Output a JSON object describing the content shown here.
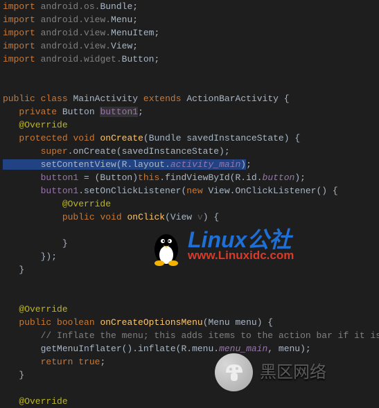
{
  "code": {
    "l1": {
      "kw": "import",
      "p": "android.os.",
      "c": "Bundle",
      "e": ";"
    },
    "l2": {
      "kw": "import",
      "p": "android.view.",
      "c": "Menu",
      "e": ";"
    },
    "l3": {
      "kw": "import",
      "p": "android.view.",
      "c": "MenuItem",
      "e": ";"
    },
    "l4": {
      "kw": "import",
      "p": "android.view.",
      "c": "View",
      "e": ";"
    },
    "l5": {
      "kw": "import",
      "p": "android.widget.",
      "c": "Button",
      "e": ";"
    },
    "l6": "",
    "l7": "",
    "l8": {
      "kw1": "public",
      "kw2": "class",
      "name": "MainActivity",
      "ext": "extends",
      "sup": "ActionBarActivity",
      "br": "{"
    },
    "l9": {
      "kw": "private",
      "type": "Button",
      "fld": "button1",
      "e": ";"
    },
    "l10": {
      "ann": "@Override"
    },
    "l11": {
      "kw1": "protected",
      "kw2": "void",
      "m": "onCreate",
      "sig": "(Bundle savedInstanceState) {"
    },
    "l12": {
      "kw": "super",
      "m": ".onCreate(savedInstanceState)",
      "e": ";"
    },
    "l13": {
      "pre": "setContentView",
      "lp": "(",
      "a": "R",
      "b": ".layout.",
      "c": "activity_main",
      "rp": ")",
      "e": ";"
    },
    "l14": {
      "fld": "button1",
      "eq": " = (Button)",
      "kw": "this",
      "m": ".findViewById(",
      "a": "R",
      "b": ".id.",
      "c": "button",
      "rp": ")",
      "e": ";"
    },
    "l15": {
      "fld": "button1",
      "m": ".setOnClickListener(",
      "kw": "new",
      "sp": " View.OnClickListener() {"
    },
    "l16": {
      "ann": "@Override"
    },
    "l17": {
      "kw1": "public",
      "kw2": "void",
      "m": "onClick",
      "sig": "(View ",
      "dim": "v",
      "sig2": ") {"
    },
    "l18": "",
    "l19": {
      "br": "}"
    },
    "l20": {
      "br": "});"
    },
    "l21": {
      "br": "}"
    },
    "l22": "",
    "l23": "",
    "l24": {
      "ann": "@Override"
    },
    "l25": {
      "kw1": "public",
      "kw2": "boolean",
      "m": "onCreateOptionsMenu",
      "sig": "(Menu menu) {"
    },
    "l26": {
      "cmt": "// Inflate the menu; this adds items to the action bar if it is present."
    },
    "l27": {
      "a": "getMenuInflater().inflate(",
      "r": "R",
      "b": ".menu.",
      "c": "menu_main",
      "d": ", menu)",
      "e": ";"
    },
    "l28": {
      "kw": "return",
      "v": "true",
      "e": ";"
    },
    "l29": {
      "br": "}"
    },
    "l30": "",
    "l31": {
      "ann": "@Override"
    }
  },
  "watermark1": {
    "top_a": "Linux",
    "top_b": "公社",
    "bottom": "www.Linuxidc.com"
  },
  "watermark2": {
    "text": "黑区网络"
  }
}
